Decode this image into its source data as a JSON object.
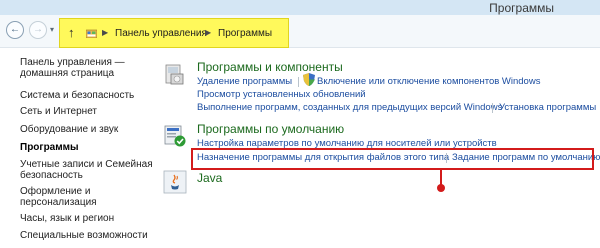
{
  "window": {
    "title": "Программы"
  },
  "address_bar": {
    "crumbs": [
      "Панель управления",
      "Программы"
    ]
  },
  "sidebar": {
    "items": [
      {
        "label": "Панель управления —"
      },
      {
        "label": "домашняя страница"
      },
      {
        "label": "Система и безопасность"
      },
      {
        "label": "Сеть и Интернет"
      },
      {
        "label": "Оборудование и звук"
      },
      {
        "label": "Программы"
      },
      {
        "label": "Учетные записи и Семейная"
      },
      {
        "label": "безопасность"
      },
      {
        "label": "Оформление и"
      },
      {
        "label": "персонализация"
      },
      {
        "label": "Часы, язык и регион"
      },
      {
        "label": "Специальные возможности"
      }
    ]
  },
  "categories": {
    "programs_features": {
      "title": "Программы и компоненты",
      "links": [
        "Удаление программы",
        "Включение или отключение компонентов Windows",
        "Просмотр установленных обновлений",
        "Выполнение программ, созданных для предыдущих версий Windows",
        "Установка программы"
      ]
    },
    "default_programs": {
      "title": "Программы по умолчанию",
      "links": [
        "Настройка параметров по умолчанию для носителей или устройств",
        "Назначение программы для открытия файлов этого типа",
        "Задание программ по умолчанию"
      ]
    },
    "java": {
      "title": "Java"
    }
  }
}
